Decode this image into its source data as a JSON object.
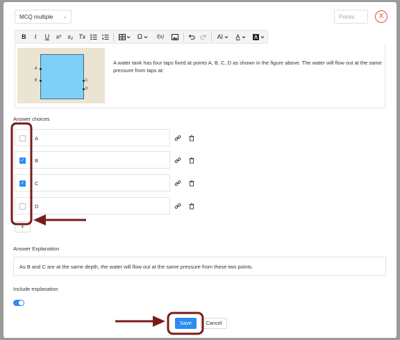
{
  "header": {
    "question_type": "MCQ multiple",
    "points_placeholder": "Points",
    "close_symbol": "X"
  },
  "toolbar": {
    "bold": "B",
    "italic": "I",
    "underline": "U",
    "superscript": "x²",
    "subscript": "x₂",
    "clear_format": "Tx",
    "omega": "Ω",
    "function": "f(x)",
    "font_size": "AI",
    "font_color": "A"
  },
  "question": {
    "text": "A water tank has four taps fixed at points A, B, C, D as shown in the figure above. The water will flow out at the same pressure from taps at:",
    "figure_labels": {
      "a": "A",
      "b": "B",
      "c": "C",
      "d": "D"
    }
  },
  "answers": {
    "label": "Answer choices",
    "choices": [
      {
        "text": "A",
        "checked": false
      },
      {
        "text": "B",
        "checked": true
      },
      {
        "text": "C",
        "checked": true
      },
      {
        "text": "D",
        "checked": false
      }
    ],
    "add_label": "+"
  },
  "explanation": {
    "label": "Answer Explanation",
    "text": "As B and C are at the same depth, the water will flow out at the same pressure from these two points."
  },
  "include_explanation": {
    "label": "Include explanation",
    "enabled": true
  },
  "footer": {
    "save_label": "Save",
    "cancel_label": "Cancel"
  },
  "colors": {
    "accent": "#2c8cf2",
    "callout": "#7a1a1a",
    "close": "#e0473a",
    "tank": "#7fcff9"
  }
}
